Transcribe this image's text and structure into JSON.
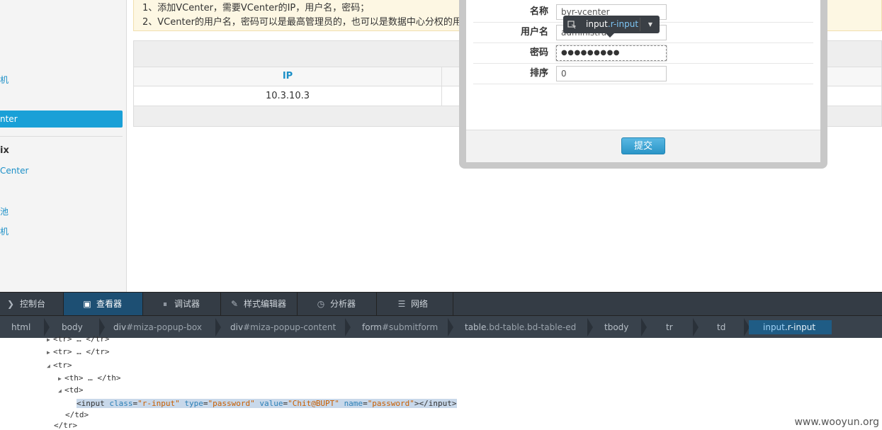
{
  "sidebar": {
    "items": [
      {
        "label": "机"
      },
      {
        "label": "nter"
      },
      {
        "label": "ix"
      },
      {
        "label": "Center"
      },
      {
        "label": "池"
      },
      {
        "label": "机"
      }
    ]
  },
  "notice": {
    "line1": "1、添加VCenter，需要VCenter的IP，用户名，密码；",
    "line2": "2、VCenter的用户名，密码可以是最高管理员的，也可以是数据中心分权的用"
  },
  "table": {
    "header_ip": "IP",
    "rows": [
      {
        "ip": "10.3.10.3"
      }
    ]
  },
  "popup": {
    "fields": [
      {
        "label": "名称",
        "value": "byr-vcenter"
      },
      {
        "label": "用户名",
        "value": "administrat"
      },
      {
        "label": "密码",
        "value": "●●●●●●●●●"
      },
      {
        "label": "排序",
        "value": "0"
      }
    ],
    "submit_label": "提交"
  },
  "tooltip": {
    "tag": "input",
    "class": ".r-input"
  },
  "devtools": {
    "tabs": [
      {
        "label": "控制台",
        "icon": "console-icon"
      },
      {
        "label": "查看器",
        "icon": "inspector-icon",
        "selected": true
      },
      {
        "label": "调试器",
        "icon": "debugger-icon"
      },
      {
        "label": "样式编辑器",
        "icon": "style-editor-icon"
      },
      {
        "label": "分析器",
        "icon": "profiler-icon"
      },
      {
        "label": "网络",
        "icon": "network-icon"
      }
    ],
    "breadcrumbs": [
      {
        "tag": "html",
        "id": ""
      },
      {
        "tag": "body",
        "id": ""
      },
      {
        "tag": "div",
        "id": "#miza-popup-box"
      },
      {
        "tag": "div",
        "id": "#miza-popup-content"
      },
      {
        "tag": "form",
        "id": "#submitform"
      },
      {
        "tag": "table",
        "id": ".bd-table.bd-table-ed"
      },
      {
        "tag": "tbody",
        "id": ""
      },
      {
        "tag": "tr",
        "id": ""
      },
      {
        "tag": "td",
        "id": ""
      },
      {
        "tag": "input",
        "id": ".r-input"
      }
    ],
    "markup": {
      "tr1": "<tr> … </tr>",
      "tr2": "<tr> … </tr>",
      "tr_open": "<tr>",
      "th": "<th> … </th>",
      "td_open": "<td>",
      "input_open": "<input ",
      "attr_class": "class",
      "val_class": "\"r-input\"",
      "attr_type": "type",
      "val_type": "\"password\"",
      "attr_value": "value",
      "val_value": "\"Chit@BUPT\"",
      "attr_name": "name",
      "val_name": "\"password\"",
      "input_close": "></input>",
      "td_close": "</td>",
      "tr_close": "</tr>"
    }
  },
  "watermark": "www.wooyun.org",
  "colors": {
    "accent": "#1aa0d7",
    "devtools_bg": "#343c45",
    "selected_tab": "#1d4f73"
  }
}
